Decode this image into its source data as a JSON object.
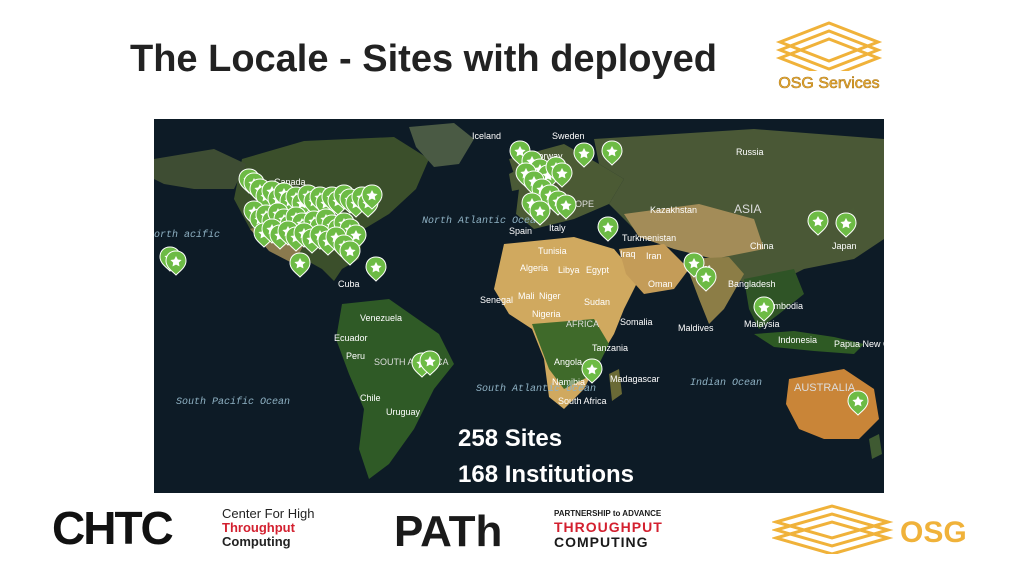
{
  "slide": {
    "title": "The Locale - Sites with deployed",
    "stats": {
      "sites": "258 Sites",
      "institutions": "168 Institutions"
    }
  },
  "map": {
    "labels": {
      "iceland": "Iceland",
      "sweden": "Sweden",
      "norway": "Norway",
      "russia": "Russia",
      "canada": "Canada",
      "europe": "EUROPE",
      "kazakhstan": "Kazakhstan",
      "asia": "ASIA",
      "north_atlantic_ocean": "North Atlantic Ocean",
      "spain": "Spain",
      "italy": "Italy",
      "turkmenistan": "Turkmenistan",
      "china": "China",
      "japan": "Japan",
      "north_pacific": "orth acific",
      "tunisia": "Tunisia",
      "iraq": "Iraq",
      "iran": "Iran",
      "algeria": "Algeria",
      "libya": "Libya",
      "egypt": "Egypt",
      "pakistan": "Pakist",
      "bangladesh": "Bangladesh",
      "cuba": "Cuba",
      "oman": "Oman",
      "senegal": "Senegal",
      "mali": "Mali",
      "niger": "Niger",
      "sudan": "Sudan",
      "cambodia": "Cambodia",
      "venezuela": "Venezuela",
      "nigeria": "Nigeria",
      "africa": "AFRICA",
      "somalia": "Somalia",
      "maldives": "Maldives",
      "malaysia": "Malaysia",
      "ecuador": "Ecuador",
      "indonesia": "Indonesia",
      "papua": "Papua New Guinea",
      "peru": "Peru",
      "south_america": "SOUTH AMERICA",
      "tanzania": "Tanzania",
      "angola": "Angola",
      "namibia": "Namibia",
      "madagascar": "Madagascar",
      "indian_ocean": "Indian Ocean",
      "south_pacific_ocean": "South Pacific Ocean",
      "chile": "Chile",
      "south_atlantic_ocean": "South Atlantic Ocean",
      "south_africa": "South Africa",
      "australia": "AUSTRALIA",
      "uruguay": "Uruguay"
    }
  },
  "logos": {
    "osg_services": "OSG Services",
    "chtc_mark": "CHTC",
    "chtc_line1": "Center For High",
    "chtc_line2": "Throughput",
    "chtc_line3": "Computing",
    "path_mark": "PATh",
    "path_line1": "PARTNERSHIP to ADVANCE",
    "path_line2": "THROUGHPUT",
    "path_line3": "COMPUTING",
    "osg": "OSG"
  },
  "colors": {
    "ocean": "#0d1b26",
    "land_dark": "#2f4424",
    "land_green": "#3d5a2c",
    "desert": "#c9a35e",
    "marker": "#6dbb45",
    "osg_gold": "#f0b23a",
    "chtc_red": "#d3202f"
  },
  "markers_icon": "map-pin-star-icon"
}
